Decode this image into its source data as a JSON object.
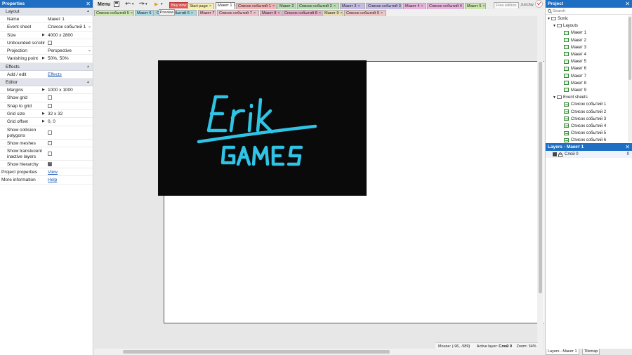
{
  "properties": {
    "title": "Properties",
    "close_glyph": "✕",
    "sections": {
      "layout": "Layout",
      "effects": "Effects",
      "editor": "Editor"
    },
    "rows": {
      "name": {
        "label": "Name",
        "value": "Макет 1"
      },
      "event_sheet": {
        "label": "Event sheet",
        "value": "Список событий 1"
      },
      "size": {
        "label": "Size",
        "value": "4000 x 2800"
      },
      "unbounded_scrolling": {
        "label": "Unbounded scrolling",
        "checked": false
      },
      "projection": {
        "label": "Projection",
        "value": "Perspective"
      },
      "vanishing_point": {
        "label": "Vanishing point",
        "value": "50%, 50%"
      },
      "add_edit": {
        "label": "Add / edit",
        "value": "Effects"
      },
      "margins": {
        "label": "Margins",
        "value": "1000 x 1000"
      },
      "show_grid": {
        "label": "Show grid",
        "checked": false
      },
      "snap_to_grid": {
        "label": "Snap to grid",
        "checked": false
      },
      "grid_size": {
        "label": "Grid size",
        "value": "32 x 32"
      },
      "grid_offset": {
        "label": "Grid offset",
        "value": "0, 0"
      },
      "show_collision": {
        "label": "Show collision polygons",
        "checked": false
      },
      "show_meshes": {
        "label": "Show meshes",
        "checked": false
      },
      "show_translucent": {
        "label": "Show translucent inactive layers",
        "checked": false
      },
      "show_hierarchy": {
        "label": "Show hierarchy",
        "checked": true
      },
      "project_properties": {
        "label": "Project properties",
        "value": "View"
      },
      "more_information": {
        "label": "More information",
        "value": "Help"
      }
    }
  },
  "toolbar": {
    "menu": "Menu",
    "play_glyph": "▶",
    "buy_now": "Buy now",
    "free_edition": "Free edition",
    "user": "JustJay",
    "tooltip": "Preview"
  },
  "tabs_row1": [
    {
      "label": "Start page",
      "color": "#f6eeb0"
    },
    {
      "label": "Макет 1",
      "color": "#ffffff"
    },
    {
      "label": "Список событий 1",
      "color": "#f2b4b4"
    },
    {
      "label": "Макет 2",
      "color": "#b8dcb4"
    },
    {
      "label": "Список событий 2",
      "color": "#b8dcb4"
    },
    {
      "label": "Макет 3",
      "color": "#c4bce4"
    },
    {
      "label": "Список событий 3",
      "color": "#c4bce4"
    },
    {
      "label": "Макет 4",
      "color": "#e6b4dc"
    },
    {
      "label": "Список событий 4",
      "color": "#e6b4dc"
    },
    {
      "label": "Макет 5",
      "color": "#cce6b0"
    }
  ],
  "tabs_row2": [
    {
      "label": "Список событий 5",
      "color": "#cce6b0"
    },
    {
      "label": "Макет 6",
      "color": "#a8d8e2"
    },
    {
      "label": "Список событий 6",
      "color": "#a8d8e2"
    },
    {
      "label": "Макет 7",
      "color": "#f0c0cc"
    },
    {
      "label": "Список событий 7",
      "color": "#f0c0cc"
    },
    {
      "label": "Макет 8",
      "color": "#e8b0c8"
    },
    {
      "label": "Список событий 8",
      "color": "#e8b0c8"
    },
    {
      "label": "Макет 9",
      "color": "#e8dcb0"
    },
    {
      "label": "Список событий 9",
      "color": "#f0c4c4"
    }
  ],
  "tab_close_glyph": "×",
  "logo": {
    "line1": "Erik",
    "line2": "GAMES",
    "color": "#2fc4e6"
  },
  "status": {
    "mouse": "Mouse: (-96, -589)",
    "active_layer_label": "Active layer:",
    "active_layer": "Слой 0",
    "zoom": "Zoom: 34%"
  },
  "project": {
    "title": "Project",
    "close_glyph": "✕",
    "search_placeholder": "Search",
    "root": "Sonic",
    "layouts_folder": "Layouts",
    "layouts": [
      "Макет 1",
      "Макет 2",
      "Макет 3",
      "Макет 4",
      "Макет 5",
      "Макет 6",
      "Макет 7",
      "Макет 8",
      "Макет 9"
    ],
    "events_folder": "Event sheets",
    "event_sheets": [
      "Список событий 1",
      "Список событий 2",
      "Список событий 3",
      "Список событий 4",
      "Список событий 5",
      "Список событий 6"
    ]
  },
  "layers": {
    "title": "Layers - Макет 1",
    "close_glyph": "✕",
    "items": [
      {
        "name": "Слой 0",
        "index": "0"
      }
    ]
  },
  "bottom_tabs": [
    "Layers - Макет 1",
    "Tilemap"
  ]
}
